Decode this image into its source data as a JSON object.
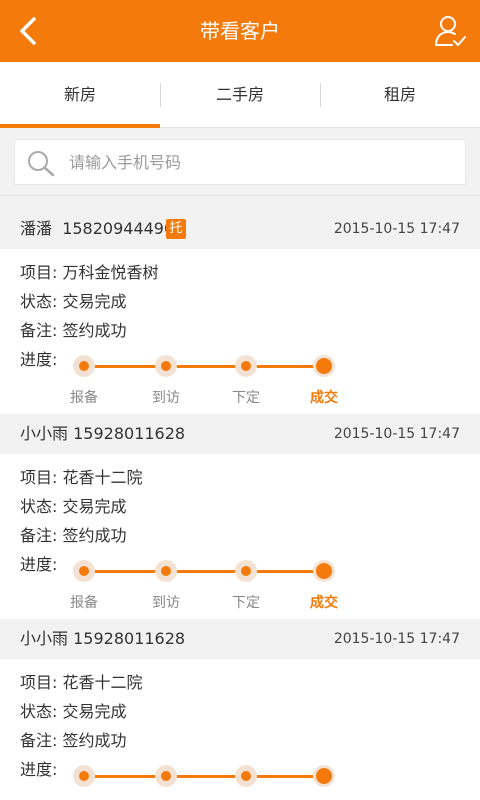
{
  "header": {
    "title": "带看客户",
    "back_icon": "back-chevron-icon",
    "user_icon": "user-check-icon",
    "bg_color": "#f47b0b"
  },
  "tabs": [
    {
      "label": "新房",
      "active": true
    },
    {
      "label": "二手房",
      "active": false
    },
    {
      "label": "租房",
      "active": false
    }
  ],
  "search": {
    "placeholder": "请输入手机号码",
    "value": ""
  },
  "labels": {
    "project": "项目:",
    "status": "状态:",
    "note": "备注:",
    "progress": "进度:"
  },
  "stages": [
    "报备",
    "到访",
    "下定",
    "成交"
  ],
  "customers": [
    {
      "name": "潘潘",
      "phone": "15820944490",
      "badge": "托",
      "time": "2015-10-15 17:47",
      "project": "万科金悦香树",
      "status": "交易完成",
      "note": "签约成功",
      "progress_stage": 4
    },
    {
      "name": "小小雨",
      "phone": "15928011628",
      "badge": "",
      "time": "2015-10-15 17:47",
      "project": "花香十二院",
      "status": "交易完成",
      "note": "签约成功",
      "progress_stage": 4
    },
    {
      "name": "小小雨",
      "phone": "15928011628",
      "badge": "",
      "time": "2015-10-15 17:47",
      "project": "花香十二院",
      "status": "交易完成",
      "note": "签约成功",
      "progress_stage": 4
    }
  ]
}
